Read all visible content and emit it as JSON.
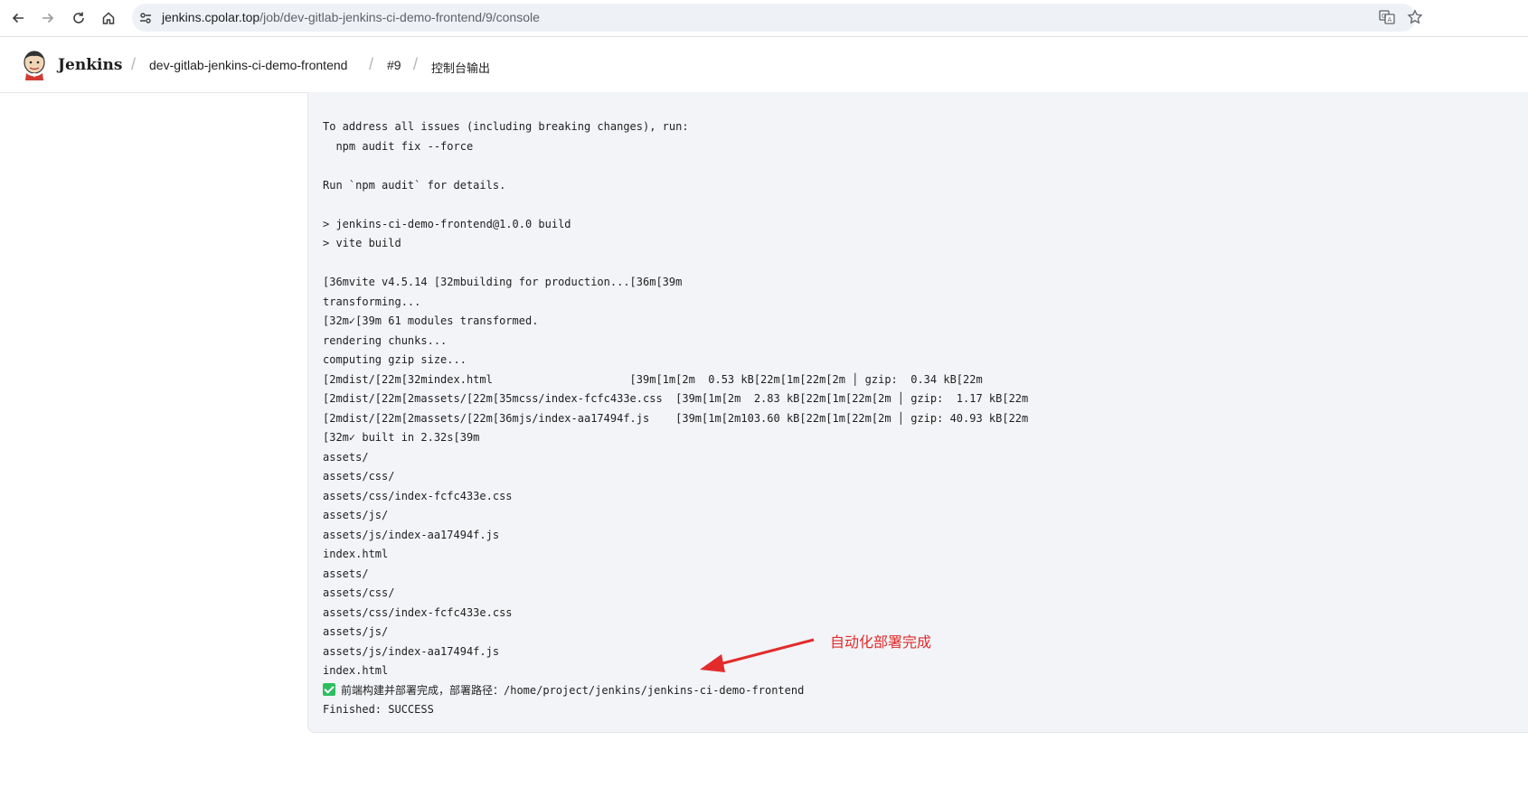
{
  "browser": {
    "url_host": "jenkins.cpolar.top",
    "url_path": "/job/dev-gitlab-jenkins-ci-demo-frontend/9/console",
    "back_icon": "arrow-left-icon",
    "forward_icon": "arrow-right-icon",
    "reload_icon": "reload-icon",
    "home_icon": "home-icon",
    "site_info_icon": "tune-icon",
    "translate_icon": "translate-icon",
    "bookmark_icon": "star-icon"
  },
  "header": {
    "brand": "Jenkins",
    "breadcrumbs": [
      "dev-gitlab-jenkins-ci-demo-frontend",
      "#9",
      "控制台输出"
    ],
    "separator": "/"
  },
  "console": {
    "lines": [
      "To address all issues (including breaking changes), run:",
      "  npm audit fix --force",
      "",
      "Run `npm audit` for details.",
      "",
      "> jenkins-ci-demo-frontend@1.0.0 build",
      "> vite build",
      "",
      "[36mvite v4.5.14 [32mbuilding for production...[36m[39m",
      "transforming...",
      "[32m✓[39m 61 modules transformed.",
      "rendering chunks...",
      "computing gzip size...",
      "[2mdist/[22m[32mindex.html                     [39m[1m[2m  0.53 kB[22m[1m[22m[2m │ gzip:  0.34 kB[22m",
      "[2mdist/[22m[2massets/[22m[35mcss/index-fcfc433e.css  [39m[1m[2m  2.83 kB[22m[1m[22m[2m │ gzip:  1.17 kB[22m",
      "[2mdist/[22m[2massets/[22m[36mjs/index-aa17494f.js    [39m[1m[2m103.60 kB[22m[1m[22m[2m │ gzip: 40.93 kB[22m",
      "[32m✓ built in 2.32s[39m",
      "assets/",
      "assets/css/",
      "assets/css/index-fcfc433e.css",
      "assets/js/",
      "assets/js/index-aa17494f.js",
      "index.html",
      "assets/",
      "assets/css/",
      "assets/css/index-fcfc433e.css",
      "assets/js/",
      "assets/js/index-aa17494f.js",
      "index.html"
    ],
    "success_line": "前端构建并部署完成，部署路径：/home/project/jenkins/jenkins-ci-demo-frontend",
    "success_icon": "green-check-icon",
    "finished_line": "Finished: SUCCESS"
  },
  "annotation": {
    "text": "自动化部署完成",
    "color": "#e32b2b"
  }
}
